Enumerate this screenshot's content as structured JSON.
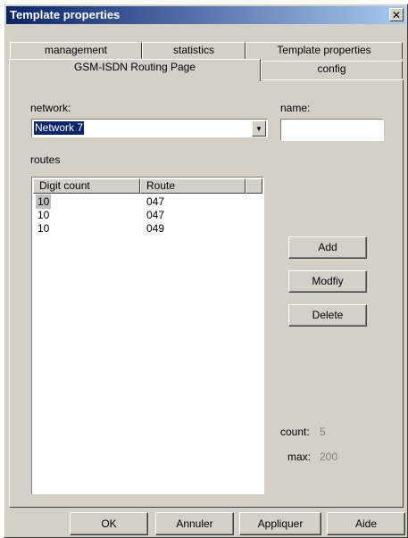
{
  "window": {
    "title": "Template properties",
    "close_glyph": "✕"
  },
  "tabs_back": [
    "management",
    "statistics",
    "Template properties"
  ],
  "tabs_front": [
    "GSM-ISDN Routing Page",
    "config"
  ],
  "form": {
    "network_label": "network:",
    "network_value": "Network 7",
    "name_label": "name:",
    "name_value": "",
    "routes_label": "routes"
  },
  "routes_table": {
    "columns": [
      "Digit count",
      "Route"
    ],
    "rows": [
      {
        "digit_count": "10",
        "route": "047"
      },
      {
        "digit_count": "10",
        "route": "047"
      },
      {
        "digit_count": "10",
        "route": "049"
      }
    ]
  },
  "actions": {
    "add": "Add",
    "modify": "Modfiy",
    "delete": "Delete"
  },
  "stats": {
    "count_label": "count:",
    "count_value": "5",
    "max_label": "max:",
    "max_value": "200"
  },
  "footer": {
    "ok": "OK",
    "cancel": "Annuler",
    "apply": "Appliquer",
    "help": "Aide"
  },
  "icons": {
    "dropdown_arrow": "chevron-down-icon",
    "close": "close-icon"
  }
}
